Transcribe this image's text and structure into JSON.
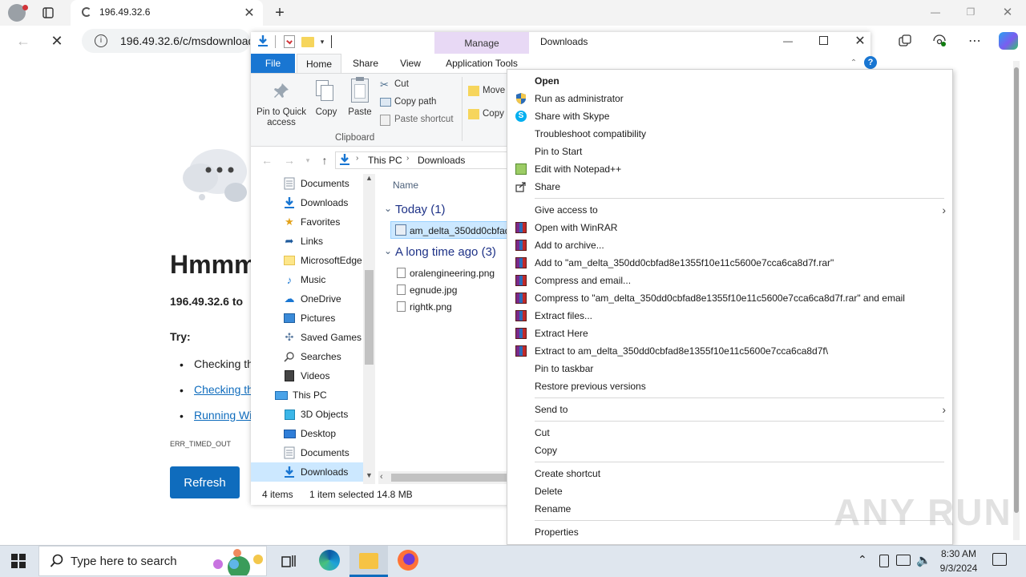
{
  "browser": {
    "tab_title": "196.49.32.6",
    "address": "196.49.32.6/c/msdownload",
    "colors": {
      "accent": "#0f6cbd"
    }
  },
  "error_page": {
    "heading": "Hmmm",
    "subtitle": "196.49.32.6 to",
    "try_label": "Try:",
    "suggestions": [
      "Checking th",
      "Checking th",
      "Running Wi"
    ],
    "error_code": "ERR_TIMED_OUT",
    "refresh_label": "Refresh"
  },
  "explorer": {
    "title": "Downloads",
    "manage_label": "Manage",
    "application_tools_label": "Application Tools",
    "ribbon_tabs": [
      "File",
      "Home",
      "Share",
      "View"
    ],
    "clipboard": {
      "pin_label": "Pin to Quick access",
      "copy_label": "Copy",
      "paste_label": "Paste",
      "cut_label": "Cut",
      "copy_path_label": "Copy path",
      "paste_shortcut_label": "Paste shortcut",
      "group_label": "Clipboard"
    },
    "organize": {
      "move_label": "Move",
      "copy_label": "Copy"
    },
    "path": [
      "This PC",
      "Downloads"
    ],
    "sidebar": [
      {
        "label": "Documents",
        "icon": "document-icon"
      },
      {
        "label": "Downloads",
        "icon": "download-icon"
      },
      {
        "label": "Favorites",
        "icon": "star-icon"
      },
      {
        "label": "Links",
        "icon": "link-icon"
      },
      {
        "label": "MicrosoftEdge",
        "icon": "folder-icon"
      },
      {
        "label": "Music",
        "icon": "music-icon"
      },
      {
        "label": "OneDrive",
        "icon": "cloud-icon"
      },
      {
        "label": "Pictures",
        "icon": "picture-icon"
      },
      {
        "label": "Saved Games",
        "icon": "game-icon"
      },
      {
        "label": "Searches",
        "icon": "search-icon"
      },
      {
        "label": "Videos",
        "icon": "video-icon"
      },
      {
        "label": "This PC",
        "icon": "computer-icon"
      },
      {
        "label": "3D Objects",
        "icon": "cube-icon"
      },
      {
        "label": "Desktop",
        "icon": "desktop-icon"
      },
      {
        "label": "Documents",
        "icon": "document-icon"
      },
      {
        "label": "Downloads",
        "icon": "download-icon"
      }
    ],
    "column_name": "Name",
    "group_today": "Today (1)",
    "group_long_ago": "A long time ago (3)",
    "selected_file": "am_delta_350dd0cbfad",
    "files": [
      "oralengineering.png",
      "egnude.jpg",
      "rightk.png"
    ],
    "status": {
      "items": "4 items",
      "selected": "1 item selected",
      "size": "14.8 MB"
    }
  },
  "context_menu": {
    "group1": [
      {
        "label": "Open",
        "icon": "",
        "bold": true
      },
      {
        "label": "Run as administrator",
        "icon": "shield-icon"
      },
      {
        "label": "Share with Skype",
        "icon": "skype-icon"
      },
      {
        "label": "Troubleshoot compatibility",
        "icon": ""
      },
      {
        "label": "Pin to Start",
        "icon": ""
      },
      {
        "label": "Edit with Notepad++",
        "icon": "notepad-icon"
      },
      {
        "label": "Share",
        "icon": "share-icon"
      }
    ],
    "group2": [
      {
        "label": "Give access to",
        "icon": "",
        "submenu": true
      },
      {
        "label": "Open with WinRAR",
        "icon": "winrar-icon"
      },
      {
        "label": "Add to archive...",
        "icon": "winrar-icon"
      },
      {
        "label": "Add to \"am_delta_350dd0cbfad8e1355f10e11c5600e7cca6ca8d7f.rar\"",
        "icon": "winrar-icon"
      },
      {
        "label": "Compress and email...",
        "icon": "winrar-icon"
      },
      {
        "label": "Compress to \"am_delta_350dd0cbfad8e1355f10e11c5600e7cca6ca8d7f.rar\" and email",
        "icon": "winrar-icon"
      },
      {
        "label": "Extract files...",
        "icon": "winrar-icon"
      },
      {
        "label": "Extract Here",
        "icon": "winrar-icon"
      },
      {
        "label": "Extract to am_delta_350dd0cbfad8e1355f10e11c5600e7cca6ca8d7f\\",
        "icon": "winrar-icon"
      },
      {
        "label": "Pin to taskbar",
        "icon": ""
      },
      {
        "label": "Restore previous versions",
        "icon": ""
      }
    ],
    "group3": [
      {
        "label": "Send to",
        "icon": "",
        "submenu": true
      }
    ],
    "group4": [
      {
        "label": "Cut",
        "icon": ""
      },
      {
        "label": "Copy",
        "icon": ""
      }
    ],
    "group5": [
      {
        "label": "Create shortcut",
        "icon": ""
      },
      {
        "label": "Delete",
        "icon": ""
      },
      {
        "label": "Rename",
        "icon": ""
      }
    ],
    "group6": [
      {
        "label": "Properties",
        "icon": ""
      }
    ]
  },
  "taskbar": {
    "search_placeholder": "Type here to search",
    "time": "8:30 AM",
    "date": "9/3/2024"
  },
  "watermark": "ANY RUN"
}
